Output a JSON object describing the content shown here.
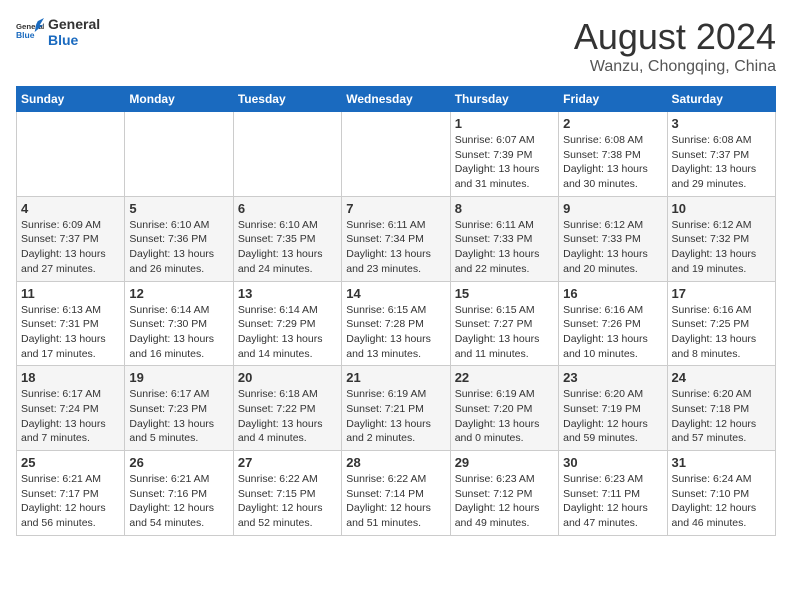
{
  "header": {
    "logo_line1": "General",
    "logo_line2": "Blue",
    "main_title": "August 2024",
    "subtitle": "Wanzu, Chongqing, China"
  },
  "weekdays": [
    "Sunday",
    "Monday",
    "Tuesday",
    "Wednesday",
    "Thursday",
    "Friday",
    "Saturday"
  ],
  "weeks": [
    [
      {
        "day": "",
        "info": ""
      },
      {
        "day": "",
        "info": ""
      },
      {
        "day": "",
        "info": ""
      },
      {
        "day": "",
        "info": ""
      },
      {
        "day": "1",
        "info": "Sunrise: 6:07 AM\nSunset: 7:39 PM\nDaylight: 13 hours\nand 31 minutes."
      },
      {
        "day": "2",
        "info": "Sunrise: 6:08 AM\nSunset: 7:38 PM\nDaylight: 13 hours\nand 30 minutes."
      },
      {
        "day": "3",
        "info": "Sunrise: 6:08 AM\nSunset: 7:37 PM\nDaylight: 13 hours\nand 29 minutes."
      }
    ],
    [
      {
        "day": "4",
        "info": "Sunrise: 6:09 AM\nSunset: 7:37 PM\nDaylight: 13 hours\nand 27 minutes."
      },
      {
        "day": "5",
        "info": "Sunrise: 6:10 AM\nSunset: 7:36 PM\nDaylight: 13 hours\nand 26 minutes."
      },
      {
        "day": "6",
        "info": "Sunrise: 6:10 AM\nSunset: 7:35 PM\nDaylight: 13 hours\nand 24 minutes."
      },
      {
        "day": "7",
        "info": "Sunrise: 6:11 AM\nSunset: 7:34 PM\nDaylight: 13 hours\nand 23 minutes."
      },
      {
        "day": "8",
        "info": "Sunrise: 6:11 AM\nSunset: 7:33 PM\nDaylight: 13 hours\nand 22 minutes."
      },
      {
        "day": "9",
        "info": "Sunrise: 6:12 AM\nSunset: 7:33 PM\nDaylight: 13 hours\nand 20 minutes."
      },
      {
        "day": "10",
        "info": "Sunrise: 6:12 AM\nSunset: 7:32 PM\nDaylight: 13 hours\nand 19 minutes."
      }
    ],
    [
      {
        "day": "11",
        "info": "Sunrise: 6:13 AM\nSunset: 7:31 PM\nDaylight: 13 hours\nand 17 minutes."
      },
      {
        "day": "12",
        "info": "Sunrise: 6:14 AM\nSunset: 7:30 PM\nDaylight: 13 hours\nand 16 minutes."
      },
      {
        "day": "13",
        "info": "Sunrise: 6:14 AM\nSunset: 7:29 PM\nDaylight: 13 hours\nand 14 minutes."
      },
      {
        "day": "14",
        "info": "Sunrise: 6:15 AM\nSunset: 7:28 PM\nDaylight: 13 hours\nand 13 minutes."
      },
      {
        "day": "15",
        "info": "Sunrise: 6:15 AM\nSunset: 7:27 PM\nDaylight: 13 hours\nand 11 minutes."
      },
      {
        "day": "16",
        "info": "Sunrise: 6:16 AM\nSunset: 7:26 PM\nDaylight: 13 hours\nand 10 minutes."
      },
      {
        "day": "17",
        "info": "Sunrise: 6:16 AM\nSunset: 7:25 PM\nDaylight: 13 hours\nand 8 minutes."
      }
    ],
    [
      {
        "day": "18",
        "info": "Sunrise: 6:17 AM\nSunset: 7:24 PM\nDaylight: 13 hours\nand 7 minutes."
      },
      {
        "day": "19",
        "info": "Sunrise: 6:17 AM\nSunset: 7:23 PM\nDaylight: 13 hours\nand 5 minutes."
      },
      {
        "day": "20",
        "info": "Sunrise: 6:18 AM\nSunset: 7:22 PM\nDaylight: 13 hours\nand 4 minutes."
      },
      {
        "day": "21",
        "info": "Sunrise: 6:19 AM\nSunset: 7:21 PM\nDaylight: 13 hours\nand 2 minutes."
      },
      {
        "day": "22",
        "info": "Sunrise: 6:19 AM\nSunset: 7:20 PM\nDaylight: 13 hours\nand 0 minutes."
      },
      {
        "day": "23",
        "info": "Sunrise: 6:20 AM\nSunset: 7:19 PM\nDaylight: 12 hours\nand 59 minutes."
      },
      {
        "day": "24",
        "info": "Sunrise: 6:20 AM\nSunset: 7:18 PM\nDaylight: 12 hours\nand 57 minutes."
      }
    ],
    [
      {
        "day": "25",
        "info": "Sunrise: 6:21 AM\nSunset: 7:17 PM\nDaylight: 12 hours\nand 56 minutes."
      },
      {
        "day": "26",
        "info": "Sunrise: 6:21 AM\nSunset: 7:16 PM\nDaylight: 12 hours\nand 54 minutes."
      },
      {
        "day": "27",
        "info": "Sunrise: 6:22 AM\nSunset: 7:15 PM\nDaylight: 12 hours\nand 52 minutes."
      },
      {
        "day": "28",
        "info": "Sunrise: 6:22 AM\nSunset: 7:14 PM\nDaylight: 12 hours\nand 51 minutes."
      },
      {
        "day": "29",
        "info": "Sunrise: 6:23 AM\nSunset: 7:12 PM\nDaylight: 12 hours\nand 49 minutes."
      },
      {
        "day": "30",
        "info": "Sunrise: 6:23 AM\nSunset: 7:11 PM\nDaylight: 12 hours\nand 47 minutes."
      },
      {
        "day": "31",
        "info": "Sunrise: 6:24 AM\nSunset: 7:10 PM\nDaylight: 12 hours\nand 46 minutes."
      }
    ]
  ]
}
